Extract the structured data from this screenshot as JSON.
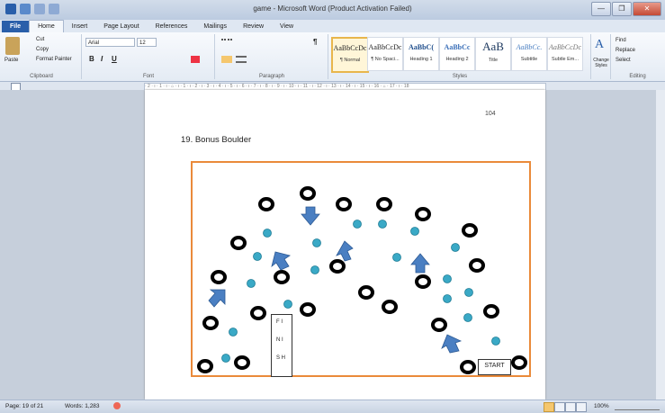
{
  "window": {
    "title": "game - Microsoft Word (Product Activation Failed)",
    "buttons": [
      "—",
      "❐",
      "✕"
    ]
  },
  "tabs": [
    "File",
    "Home",
    "Insert",
    "Page Layout",
    "References",
    "Mailings",
    "Review",
    "View"
  ],
  "ribbon": {
    "clipboard": {
      "paste": "Paste",
      "cut": "Cut",
      "copy": "Copy",
      "format_painter": "Format Painter",
      "label": "Clipboard"
    },
    "font": {
      "family": "Arial",
      "size": "12",
      "label": "Font"
    },
    "paragraph": {
      "label": "Paragraph"
    },
    "styles": {
      "label": "Styles",
      "items": [
        {
          "sample": "AaBbCcDc",
          "name": "¶ Normal"
        },
        {
          "sample": "AaBbCcDc",
          "name": "¶ No Spaci..."
        },
        {
          "sample": "AaBbC(",
          "name": "Heading 1"
        },
        {
          "sample": "AaBbCc",
          "name": "Heading 2"
        },
        {
          "sample": "AaB",
          "name": "Title"
        },
        {
          "sample": "AaBbCc.",
          "name": "Subtitle"
        },
        {
          "sample": "AaBbCcDc",
          "name": "Subtle Em..."
        }
      ],
      "change": "Change Styles"
    },
    "editing": {
      "find": "Find",
      "replace": "Replace",
      "select": "Select",
      "label": "Editing"
    }
  },
  "ruler": {
    "text": "· 2 · ı · 1 · ı · ⌂ · ı · 1 · ı · 2 · ı · 3 · ı · 4 · ı · 5 · ı · 6 · ı · 7 · ı · 8 · ı · 9 · ı · 10 · ı · 11 · ı · 12 · ı · 13 · ı · 14 · ı · 15 · ı · 16 · ⌂ · 17 · ı · 18"
  },
  "document": {
    "page_number": "104",
    "heading": "19. Bonus Boulder",
    "finish_letters": [
      "F I",
      "N I",
      "S H"
    ],
    "start_label": "START"
  },
  "status": {
    "page": "Page: 19 of 21",
    "words": "Words: 1,283",
    "zoom": "100%"
  },
  "colors": {
    "accent": "#2a5faa",
    "orange_border": "#ea8a3a",
    "teal_dot": "#3aa9c6",
    "arrow": "#4a7fc2"
  }
}
